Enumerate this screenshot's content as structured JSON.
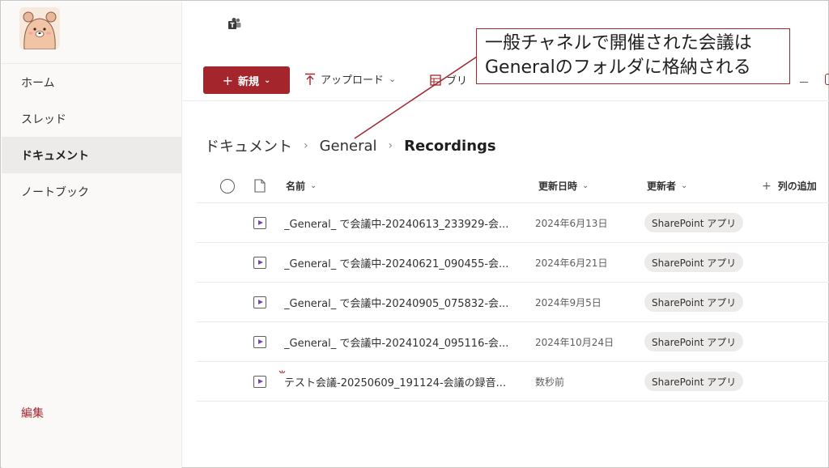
{
  "sidebar": {
    "items": [
      {
        "label": "ホーム",
        "active": false
      },
      {
        "label": "スレッド",
        "active": false
      },
      {
        "label": "ドキュメント",
        "active": true
      },
      {
        "label": "ノートブック",
        "active": false
      }
    ],
    "edit_label": "編集"
  },
  "toolbar": {
    "new_label": "新規",
    "upload_label": "アップロード",
    "partial_label": "ブリ"
  },
  "callout": {
    "line1": "一般チャネルで開催された会議は",
    "line2": "Generalのフォルダに格納される"
  },
  "breadcrumb": {
    "root": "ドキュメント",
    "middle": "General",
    "current": "Recordings"
  },
  "table": {
    "headers": {
      "name": "名前",
      "modified": "更新日時",
      "modified_by": "更新者",
      "add_column": "列の追加"
    },
    "rows": [
      {
        "name": "_General_ で会議中-20240613_233929-会...",
        "modified": "2024年6月13日",
        "modified_by": "SharePoint アプリ",
        "is_new": false
      },
      {
        "name": "_General_ で会議中-20240621_090455-会...",
        "modified": "2024年6月21日",
        "modified_by": "SharePoint アプリ",
        "is_new": false
      },
      {
        "name": "_General_ で会議中-20240905_075832-会...",
        "modified": "2024年9月5日",
        "modified_by": "SharePoint アプリ",
        "is_new": false
      },
      {
        "name": "_General_ で会議中-20241024_095116-会...",
        "modified": "2024年10月24日",
        "modified_by": "SharePoint アプリ",
        "is_new": false
      },
      {
        "name": "テスト会議-20250609_191124-会議の録音...",
        "modified": "数秒前",
        "modified_by": "SharePoint アプリ",
        "is_new": true
      }
    ]
  },
  "colors": {
    "accent": "#a4262c",
    "video_icon": "#7b3fb5"
  }
}
